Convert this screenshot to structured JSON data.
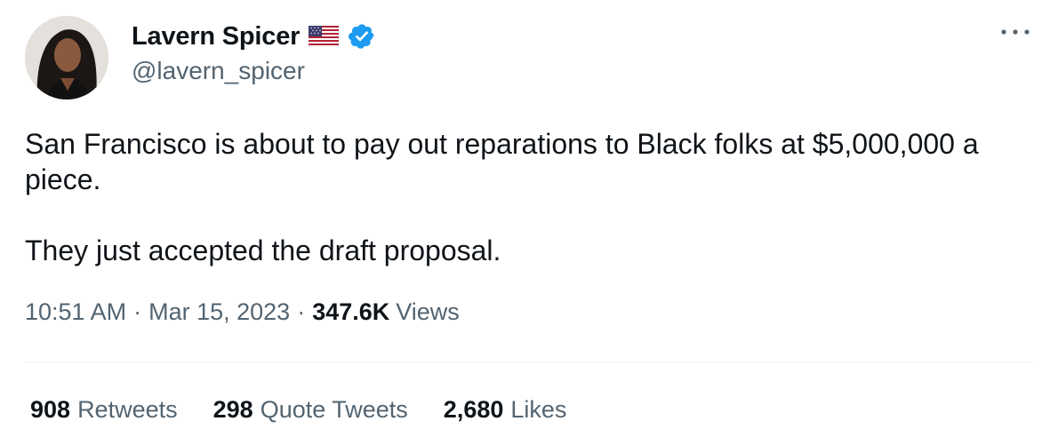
{
  "author": {
    "display_name": "Lavern Spicer",
    "handle": "@lavern_spicer",
    "avatar": "profile-photo",
    "badges": [
      "us-flag-icon",
      "verified-badge-icon"
    ]
  },
  "tweet": {
    "paragraphs": [
      "San Francisco is about to pay out reparations to Black folks at $5,000,000 a piece.",
      "They just accepted the draft proposal."
    ]
  },
  "meta": {
    "time": "10:51 AM",
    "date": "Mar 15, 2023",
    "separator": "·",
    "views_count": "347.6K",
    "views_label": "Views"
  },
  "stats": {
    "retweets": {
      "count": "908",
      "label": "Retweets"
    },
    "quote_tweets": {
      "count": "298",
      "label": "Quote Tweets"
    },
    "likes": {
      "count": "2,680",
      "label": "Likes"
    }
  },
  "colors": {
    "text_primary": "#0f1419",
    "text_secondary": "#536471",
    "verified_blue": "#1d9bf0",
    "divider": "#eff3f4"
  }
}
